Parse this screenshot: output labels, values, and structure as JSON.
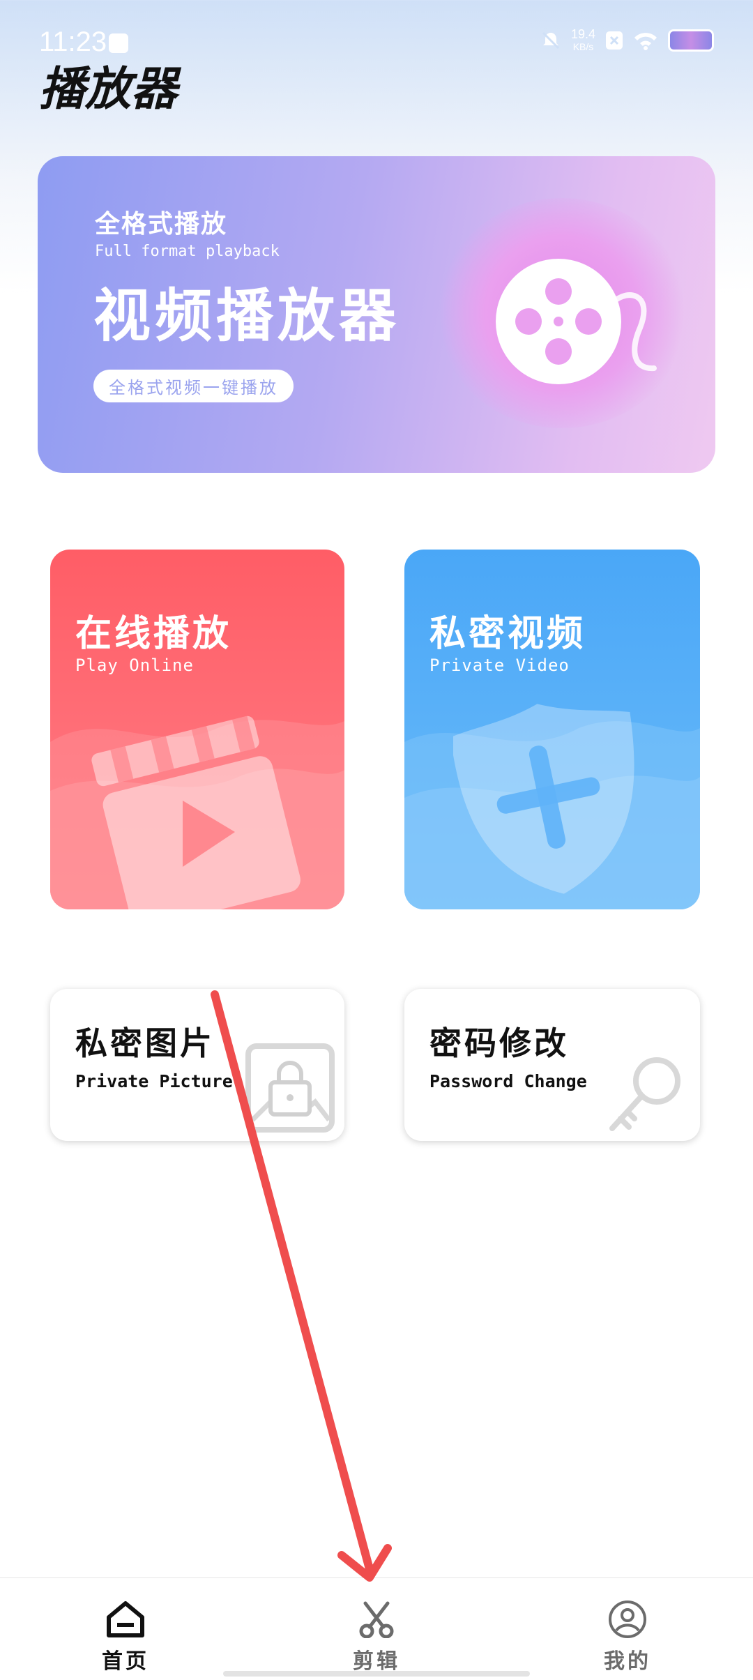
{
  "status_bar": {
    "time": "11:23",
    "speed_value": "19.4",
    "speed_unit": "KB/s"
  },
  "app": {
    "title": "播放器"
  },
  "banner": {
    "small_title": "全格式播放",
    "english": "Full format playback",
    "big_title": "视频播放器",
    "pill": "全格式视频一键播放"
  },
  "cards": {
    "play_online": {
      "title": "在线播放",
      "subtitle": "Play Online",
      "color": "#ff5d66"
    },
    "private_video": {
      "title": "私密视频",
      "subtitle": "Private Video",
      "color": "#4aa7f7"
    },
    "private_picture": {
      "title": "私密图片",
      "subtitle": "Private Picture"
    },
    "password_change": {
      "title": "密码修改",
      "subtitle": "Password Change"
    }
  },
  "nav": {
    "items": [
      {
        "label": "首页",
        "icon": "home-icon",
        "active": true
      },
      {
        "label": "剪辑",
        "icon": "scissors-icon",
        "active": false
      },
      {
        "label": "我的",
        "icon": "profile-icon",
        "active": false
      }
    ]
  },
  "annotation": {
    "arrow_color": "#ef4d4d"
  }
}
